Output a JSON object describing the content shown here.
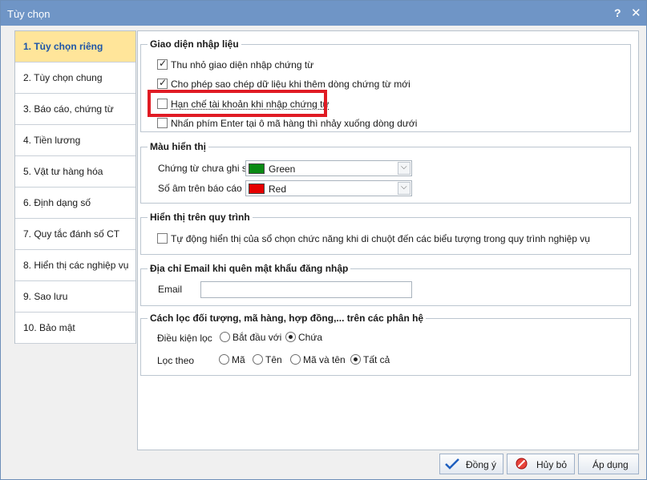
{
  "window": {
    "title": "Tùy chọn",
    "help": "?",
    "close": "✕"
  },
  "sidebar": {
    "items": [
      {
        "label": "1. Tùy chọn riêng",
        "active": true
      },
      {
        "label": "2. Tùy chọn chung"
      },
      {
        "label": "3. Báo cáo, chứng từ"
      },
      {
        "label": "4. Tiền lương"
      },
      {
        "label": "5. Vật tư hàng hóa"
      },
      {
        "label": "6. Định dạng số"
      },
      {
        "label": "7. Quy tắc đánh số CT"
      },
      {
        "label": "8. Hiển thị các nghiệp vụ"
      },
      {
        "label": "9. Sao lưu"
      },
      {
        "label": "10. Bảo mật"
      }
    ]
  },
  "input_ui": {
    "title": "Giao diện nhập liệu",
    "options": [
      {
        "label": "Thu nhỏ giao diện nhập chứng từ",
        "checked": true
      },
      {
        "label": "Cho phép sao chép dữ liệu khi thêm dòng chứng từ mới",
        "checked": true
      },
      {
        "label": "Hạn chế tài khoản khi nhập chứng từ",
        "checked": false
      },
      {
        "label": "Nhấn phím Enter tại ô mã hàng thì nhảy xuống dòng dưới",
        "checked": false
      }
    ]
  },
  "colors": {
    "title": "Màu hiển thị",
    "unposted_label": "Chứng từ chưa ghi sổ",
    "unposted_value": "Green",
    "unposted_color": "#0b8a14",
    "negative_label": "Số âm trên báo cáo",
    "negative_value": "Red",
    "negative_color": "#e60000"
  },
  "workflow": {
    "title": "Hiển thị trên quy trình",
    "option_label": "Tự động hiển thị của sổ chọn chức năng khi di chuột đến các biểu tượng trong quy trình nghiệp vụ",
    "checked": false
  },
  "email": {
    "title": "Địa chỉ Email khi quên mật khẩu đăng nhập",
    "label": "Email",
    "value": ""
  },
  "filter": {
    "title": "Cách lọc đối tượng, mã hàng, hợp đồng,... trên các phân hệ",
    "condition_label": "Điều kiện lọc",
    "condition_options": [
      "Bắt đầu với",
      "Chứa"
    ],
    "condition_selected": "Chứa",
    "filter_by_label": "Lọc theo",
    "filter_by_options": [
      "Mã",
      "Tên",
      "Mã và tên",
      "Tất cả"
    ],
    "filter_by_selected": "Tất cả"
  },
  "footer": {
    "ok_label": "Đồng ý",
    "cancel_label": "Hủy bỏ",
    "apply_label": "Áp dụng"
  }
}
